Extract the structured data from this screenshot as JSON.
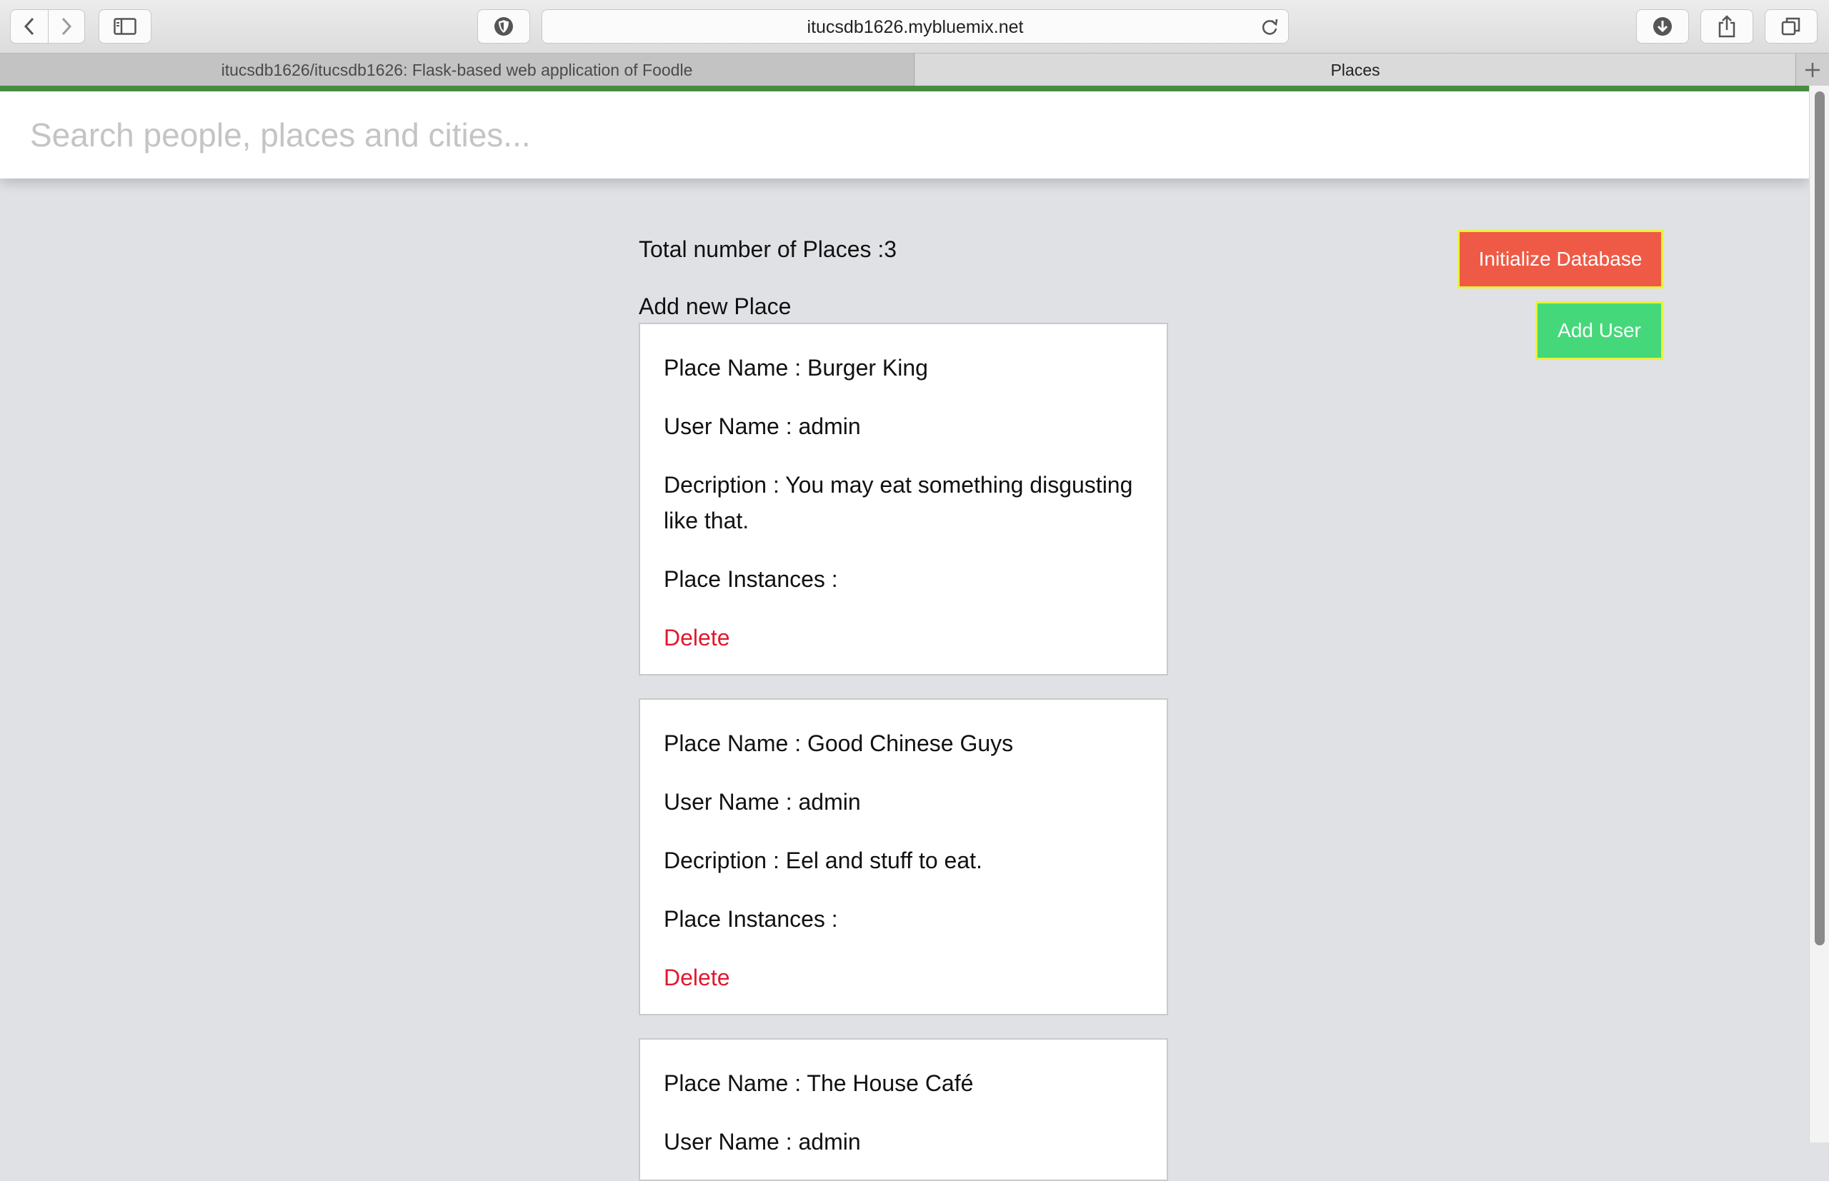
{
  "browser": {
    "url": "itucsdb1626.mybluemix.net",
    "tabs": [
      {
        "label": "itucsdb1626/itucsdb1626: Flask-based web application of Foodle"
      },
      {
        "label": "Places"
      }
    ]
  },
  "search": {
    "placeholder": "Search people, places and cities..."
  },
  "summary": {
    "total_label": "Total number of Places :3",
    "add_new_label": "Add new Place"
  },
  "actions": {
    "init_db": "Initialize Database",
    "add_user": "Add User"
  },
  "places": [
    {
      "name": "Place Name : Burger King",
      "user": "User Name : admin",
      "description": "Decription : You may eat something disgusting like that.",
      "instances": "Place Instances :",
      "delete": "Delete"
    },
    {
      "name": "Place Name : Good Chinese Guys",
      "user": "User Name : admin",
      "description": "Decription : Eel and stuff to eat.",
      "instances": "Place Instances :",
      "delete": "Delete"
    },
    {
      "name": "Place Name : The House Café",
      "user": "User Name : admin"
    }
  ],
  "colors": {
    "init_button": "#ef5a46",
    "add_user_button": "#45d87a",
    "button_border": "#e8f23a",
    "delete_link": "#e2182e",
    "progress_bar": "#4a8f42"
  }
}
